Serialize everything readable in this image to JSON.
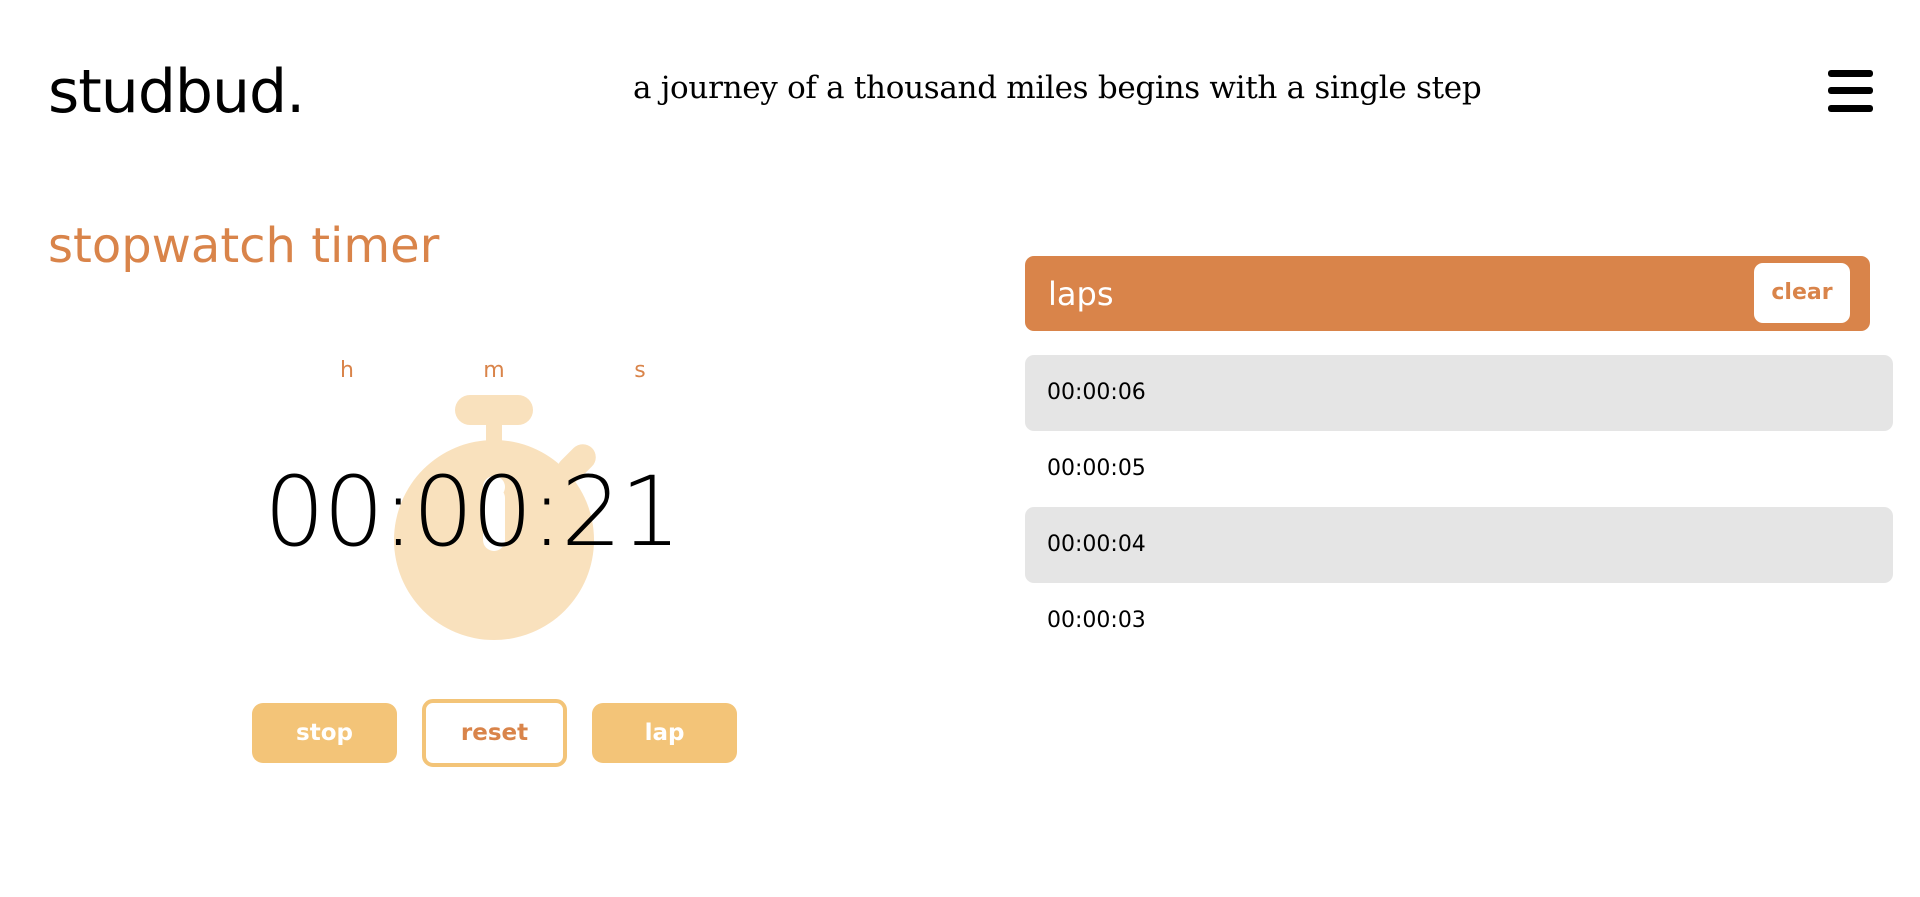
{
  "header": {
    "logo": "studbud.",
    "quote": "a journey of a thousand miles begins with a single step",
    "menu_icon": "hamburger-menu-icon"
  },
  "stopwatch": {
    "title": "stopwatch timer",
    "units": {
      "hours": "h",
      "minutes": "m",
      "seconds": "s"
    },
    "time": "00:00:21",
    "watch_icon": "stopwatch-icon",
    "buttons": {
      "stop": "stop",
      "reset": "reset",
      "lap": "lap"
    },
    "colors": {
      "accent": "#d9844a",
      "button": "#f3c478",
      "watch": "#f9e1bd"
    }
  },
  "laps": {
    "title": "laps",
    "clear_label": "clear",
    "items": [
      "00:00:06",
      "00:00:05",
      "00:00:04",
      "00:00:03"
    ]
  }
}
